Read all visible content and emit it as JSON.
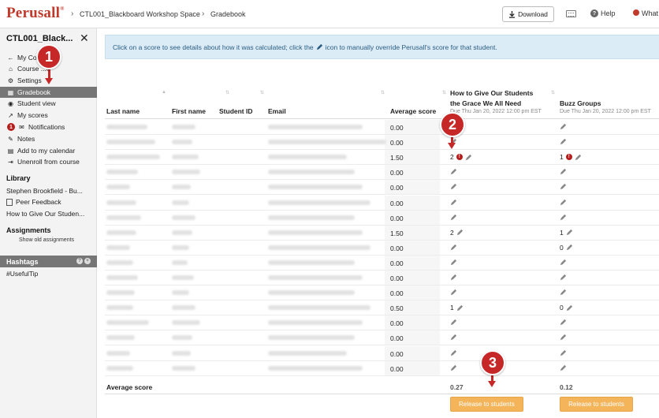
{
  "header": {
    "logo": "Perusall",
    "logo_mark": "®",
    "breadcrumb_course": "CTL001_Blackboard Workshop Space",
    "breadcrumb_page": "Gradebook",
    "download_label": "Download",
    "help_label": "Help",
    "whats_new_label": "What"
  },
  "sidebar": {
    "course_title": "CTL001_Black...",
    "nav": [
      {
        "label": "My Co...",
        "icon": "arrow-left-icon"
      },
      {
        "label": "Course ...e",
        "icon": "home-icon"
      },
      {
        "label": "Settings",
        "icon": "gear-icon"
      },
      {
        "label": "Gradebook",
        "icon": "table-icon",
        "active": true
      },
      {
        "label": "Student view",
        "icon": "eye-icon"
      },
      {
        "label": "My scores",
        "icon": "chart-icon"
      },
      {
        "label": "Notifications",
        "icon": "envelope-icon",
        "badge": "1"
      },
      {
        "label": "Notes",
        "icon": "pencil-icon"
      },
      {
        "label": "Add to my calendar",
        "icon": "calendar-icon"
      },
      {
        "label": "Unenroll from course",
        "icon": "sign-out-icon"
      }
    ],
    "library_heading": "Library",
    "library_items": [
      "Stephen Brookfield - Bu...",
      "Peer Feedback",
      "How to Give Our Studen..."
    ],
    "assignments_heading": "Assignments",
    "show_old": "Show old assignments",
    "hashtags_heading": "Hashtags",
    "hashtag": "#UsefulTip"
  },
  "banner": {
    "text_before": "Click on a score to see details about how it was calculated; click the",
    "text_after": "icon to manually override Perusall's score for that student."
  },
  "table": {
    "headers": {
      "last_name": "Last name",
      "first_name": "First name",
      "student_id": "Student ID",
      "email": "Email",
      "average_score": "Average score",
      "a1_line1": "How to Give Our Students",
      "a1_line2": "the Grace We All Need",
      "a1_due": "Due Thu Jan 20, 2022 12:00 pm EST",
      "a2_title": "Buzz Groups",
      "a2_due": "Due Thu Jan 20, 2022 12:00 pm EST"
    },
    "rows": [
      {
        "avg": "0.00",
        "a1": "",
        "a1_flag": false,
        "a2": "",
        "a2_flag": false
      },
      {
        "avg": "0.00",
        "a1": "",
        "a1_flag": false,
        "a2": "",
        "a2_flag": false
      },
      {
        "avg": "1.50",
        "a1": "2",
        "a1_flag": true,
        "a2": "1",
        "a2_flag": true
      },
      {
        "avg": "0.00",
        "a1": "",
        "a1_flag": false,
        "a2": "",
        "a2_flag": false
      },
      {
        "avg": "0.00",
        "a1": "",
        "a1_flag": false,
        "a2": "",
        "a2_flag": false
      },
      {
        "avg": "0.00",
        "a1": "",
        "a1_flag": false,
        "a2": "",
        "a2_flag": false
      },
      {
        "avg": "0.00",
        "a1": "",
        "a1_flag": false,
        "a2": "",
        "a2_flag": false
      },
      {
        "avg": "1.50",
        "a1": "2",
        "a1_flag": false,
        "a2": "1",
        "a2_flag": false
      },
      {
        "avg": "0.00",
        "a1": "",
        "a1_flag": false,
        "a2": "0",
        "a2_flag": false
      },
      {
        "avg": "0.00",
        "a1": "",
        "a1_flag": false,
        "a2": "",
        "a2_flag": false
      },
      {
        "avg": "0.00",
        "a1": "",
        "a1_flag": false,
        "a2": "",
        "a2_flag": false
      },
      {
        "avg": "0.00",
        "a1": "",
        "a1_flag": false,
        "a2": "",
        "a2_flag": false
      },
      {
        "avg": "0.50",
        "a1": "1",
        "a1_flag": false,
        "a2": "0",
        "a2_flag": false
      },
      {
        "avg": "0.00",
        "a1": "",
        "a1_flag": false,
        "a2": "",
        "a2_flag": false
      },
      {
        "avg": "0.00",
        "a1": "",
        "a1_flag": false,
        "a2": "",
        "a2_flag": false
      },
      {
        "avg": "0.00",
        "a1": "",
        "a1_flag": false,
        "a2": "",
        "a2_flag": false
      },
      {
        "avg": "0.00",
        "a1": "",
        "a1_flag": false,
        "a2": "",
        "a2_flag": false
      }
    ],
    "footer_label": "Average score",
    "footer_a1": "0.27",
    "footer_a2": "0.12",
    "release_label": "Release to students"
  },
  "callouts": [
    "1",
    "2",
    "3"
  ],
  "colors": {
    "brand": "#c0392b",
    "callout": "#c62828",
    "release": "#f3b45a",
    "banner_bg": "#dbecf7"
  }
}
